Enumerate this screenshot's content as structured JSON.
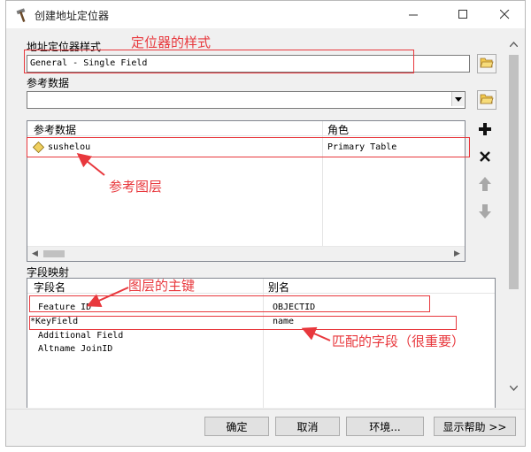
{
  "window": {
    "title": "创建地址定位器",
    "icon": "hammer-icon"
  },
  "style": {
    "label": "地址定位器样式",
    "value": "General - Single Field"
  },
  "reference": {
    "label": "参考数据",
    "value": "",
    "table": {
      "headers": [
        "参考数据",
        "角色"
      ],
      "rows": [
        {
          "name": "sushelou",
          "role": "Primary Table"
        }
      ]
    }
  },
  "field_map": {
    "label": "字段映射",
    "headers": [
      "字段名",
      "别名"
    ],
    "rows": [
      {
        "field": "Feature ID",
        "alias": "OBJECTID"
      },
      {
        "field": "*KeyField",
        "alias": "name"
      },
      {
        "field": "Additional Field",
        "alias": ""
      },
      {
        "field": "Altname JoinID",
        "alias": ""
      }
    ]
  },
  "buttons": {
    "ok": "确定",
    "cancel": "取消",
    "env": "环境...",
    "help": "显示帮助 >>"
  },
  "annotations": {
    "style": "定位器的样式",
    "layer": "参考图层",
    "key": "图层的主键",
    "match": "匹配的字段（很重要）"
  },
  "colors": {
    "annotation": "#e8383d",
    "folder": "#f2c94c",
    "diamond": "#f0d060"
  }
}
